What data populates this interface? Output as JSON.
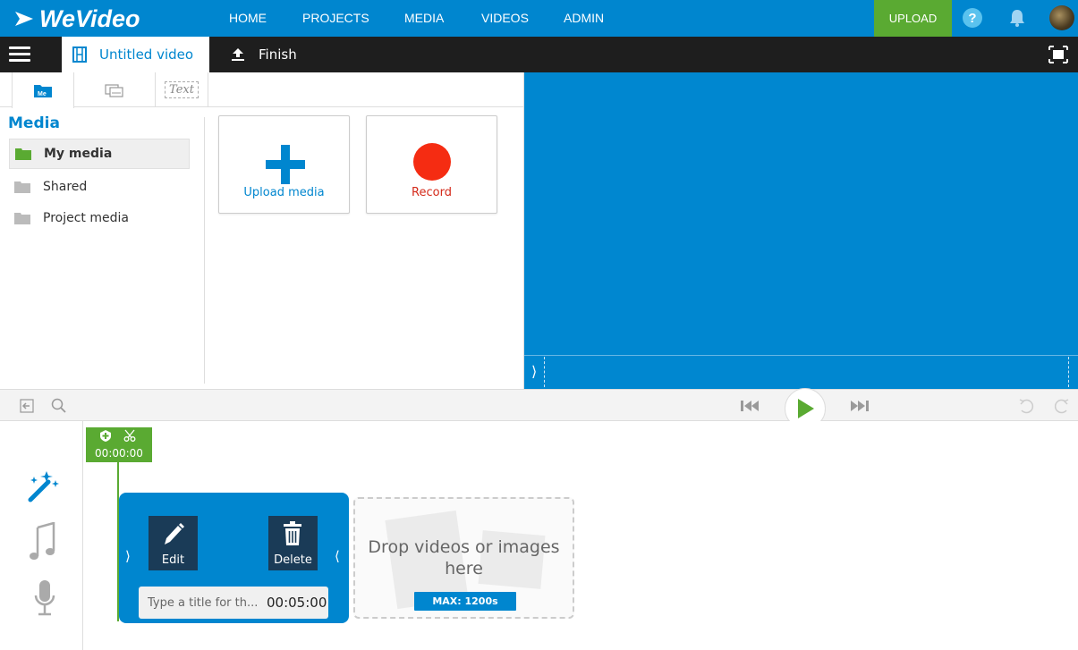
{
  "brand": {
    "logo_text": "WeVideo",
    "accent_color": "#0086cf",
    "green_color": "#5aaa32"
  },
  "topnav": {
    "links": [
      "HOME",
      "PROJECTS",
      "MEDIA",
      "VIDEOS",
      "ADMIN"
    ],
    "upload_label": "UPLOAD",
    "help_glyph": "?"
  },
  "subbar": {
    "project_title": "Untitled video",
    "finish_label": "Finish"
  },
  "library": {
    "tabs": [
      {
        "name": "media-tab",
        "icon": "folder-icon",
        "label": "Me"
      },
      {
        "name": "transitions-tab",
        "icon": "transitions-icon"
      },
      {
        "name": "text-tab",
        "label": "Text"
      }
    ],
    "heading": "Media",
    "folders": [
      {
        "label": "My media",
        "selected": true
      },
      {
        "label": "Shared",
        "selected": false
      },
      {
        "label": "Project media",
        "selected": false
      }
    ],
    "cards": [
      {
        "label": "Upload media",
        "icon": "plus-icon"
      },
      {
        "label": "Record",
        "icon": "record-icon"
      }
    ]
  },
  "transport": {
    "icons": [
      "import-icon",
      "search-icon",
      "skip-back-icon",
      "play-icon",
      "skip-forward-icon",
      "undo-icon",
      "redo-icon"
    ]
  },
  "timeline": {
    "playhead_time": "00:00:00",
    "track_icons": [
      "magic-wand-icon",
      "music-note-icon",
      "microphone-icon"
    ],
    "clip": {
      "edit_label": "Edit",
      "delete_label": "Delete",
      "title_placeholder": "Type a title for th...",
      "duration": "00:05:00"
    },
    "dropzone": {
      "text": "Drop videos or images here",
      "max_label": "MAX: 1200s"
    }
  }
}
